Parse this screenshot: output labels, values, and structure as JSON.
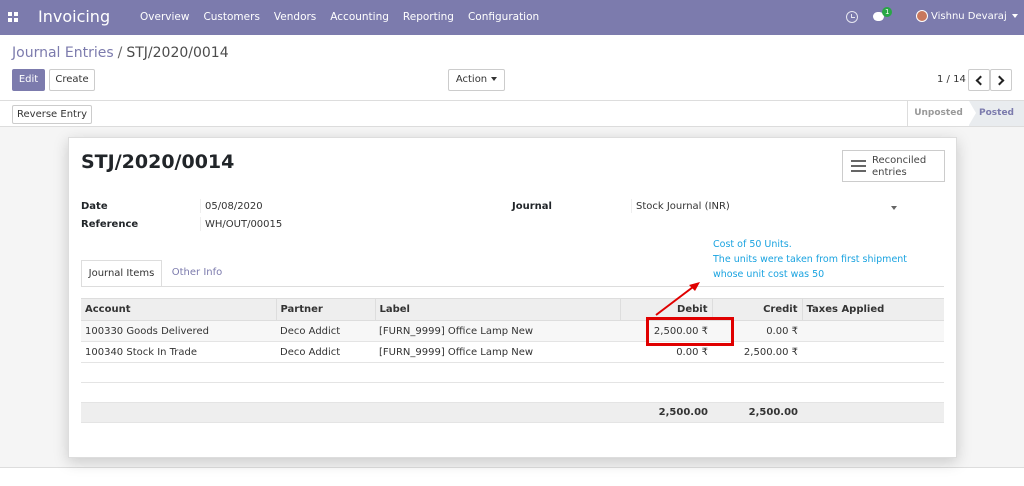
{
  "navbar": {
    "brand": "Invoicing",
    "menu": [
      "Overview",
      "Customers",
      "Vendors",
      "Accounting",
      "Reporting",
      "Configuration"
    ],
    "chat_count": "1",
    "user_name": "Vishnu Devaraj"
  },
  "breadcrumb": {
    "parent": "Journal Entries",
    "separator": "/",
    "current": "STJ/2020/0014"
  },
  "buttons": {
    "edit": "Edit",
    "create": "Create",
    "action": "Action",
    "reverse": "Reverse Entry"
  },
  "pager": {
    "text": "1 / 14"
  },
  "status": {
    "unposted": "Unposted",
    "posted": "Posted",
    "current": "Posted"
  },
  "form": {
    "title": "STJ/2020/0014",
    "reconciled": "Reconciled entries",
    "date_label": "Date",
    "date": "05/08/2020",
    "reference_label": "Reference",
    "reference": "WH/OUT/00015",
    "journal_label": "Journal",
    "journal": "Stock Journal (INR)"
  },
  "annotation": {
    "line1": "Cost of 50 Units.",
    "line2": "The units were taken from first shipment",
    "line3": "whose unit cost was 50",
    "highlight_color": "#e00000",
    "text_color": "#1aa3e0"
  },
  "tabs": [
    "Journal Items",
    "Other Info"
  ],
  "table": {
    "headers": [
      "Account",
      "Partner",
      "Label",
      "Debit",
      "Credit",
      "Taxes Applied"
    ],
    "rows": [
      {
        "account": "100330 Goods Delivered",
        "partner": "Deco Addict",
        "label": "[FURN_9999] Office Lamp New",
        "debit": "2,500.00 ₹",
        "credit": "0.00 ₹",
        "taxes": ""
      },
      {
        "account": "100340 Stock In Trade",
        "partner": "Deco Addict",
        "label": "[FURN_9999] Office Lamp New",
        "debit": "0.00 ₹",
        "credit": "2,500.00 ₹",
        "taxes": ""
      }
    ],
    "totals": {
      "debit": "2,500.00",
      "credit": "2,500.00"
    }
  },
  "colors": {
    "brand": "#7c7bad"
  }
}
